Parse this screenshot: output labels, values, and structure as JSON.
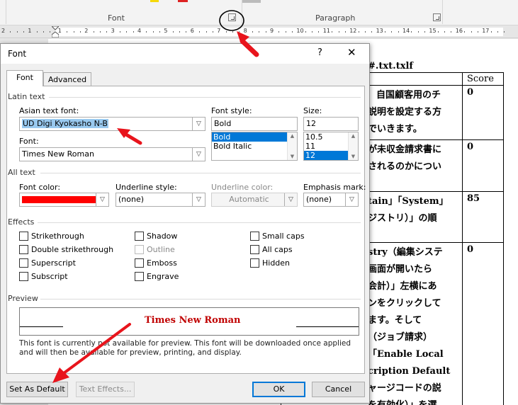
{
  "ribbon": {
    "font_group": "Font",
    "paragraph_group": "Paragraph"
  },
  "ruler": {
    "numbers": [
      "2",
      "1",
      "1",
      "2",
      "3",
      "4",
      "5",
      "6",
      "7",
      "8",
      "9",
      "10",
      "11",
      "12",
      "13",
      "14",
      "15",
      "16",
      "17"
    ]
  },
  "document": {
    "title": "#.txt.txlf",
    "table_header": "Score",
    "rows": [
      {
        "text": [
          "自国顧客用のチ",
          "説明を設定する方",
          "でいきます。"
        ],
        "score": "0"
      },
      {
        "text": [
          "が未収金請求書に",
          "されるのかについ"
        ],
        "score": "0"
      },
      {
        "text": [
          "tain」「System」",
          "ジストリ）」の順"
        ],
        "score": "85"
      },
      {
        "text": [
          "stry（編集システ",
          "画面が開いたら",
          "会計）」左横にあ",
          "ンをクリックして",
          "ます。そして",
          "（ジョブ請求）",
          "「Enable Local",
          "cription Default",
          "ャージコードの説",
          "を有効化）」を選"
        ],
        "score": "0"
      }
    ]
  },
  "dialog": {
    "title": "Font",
    "help": "?",
    "close": "✕",
    "tabs": {
      "font": "Font",
      "advanced": "Advanced"
    },
    "latin_text": "Latin text",
    "asian_font_label": "Asian text font:",
    "asian_font_value": "UD Digi Kyokasho N-B",
    "font_label": "Font:",
    "font_value": "Times New Roman",
    "style_label": "Font style:",
    "style_value": "Bold",
    "style_options": [
      "Bold",
      "Bold Italic"
    ],
    "style_selected": "Bold",
    "size_label": "Size:",
    "size_value": "12",
    "size_options": [
      "10.5",
      "11",
      "12"
    ],
    "size_selected": "12",
    "all_text": "All text",
    "font_color_label": "Font color:",
    "font_color": "#ff0000",
    "underline_style_label": "Underline style:",
    "underline_style_value": "(none)",
    "underline_color_label": "Underline color:",
    "underline_color_value": "Automatic",
    "emphasis_label": "Emphasis mark:",
    "emphasis_value": "(none)",
    "effects": "Effects",
    "effects_col1": [
      "Strikethrough",
      "Double strikethrough",
      "Superscript",
      "Subscript"
    ],
    "effects_col2": [
      "Shadow",
      "Outline",
      "Emboss",
      "Engrave"
    ],
    "effects_col3": [
      "Small caps",
      "All caps",
      "Hidden"
    ],
    "preview_label": "Preview",
    "preview_text": "Times New Roman",
    "preview_note": "This font is currently not available for preview. This font will be downloaded once applied and will then be available for preview, printing, and display.",
    "buttons": {
      "set_default": "Set As Default",
      "text_effects": "Text Effects...",
      "ok": "OK",
      "cancel": "Cancel"
    }
  }
}
